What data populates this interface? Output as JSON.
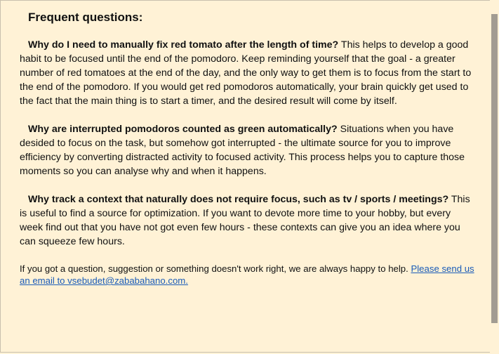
{
  "faq": {
    "title": "Frequent questions:",
    "items": [
      {
        "question": "Why do I need to manually fix red tomato after the length of time?",
        "answer": " This helps to develop a good habit to be focused until the end of the pomodoro. Keep reminding yourself that the goal - a greater number of red tomatoes at the end of the day, and the only way to get them is to focus from the start to the end of the pomodoro. If you would get red pomodoros automatically, your brain quickly get used to the fact that the main thing is to start a timer, and the desired result will come by itself."
      },
      {
        "question": "Why are interrupted pomodoros counted as green automatically?",
        "answer": " Situations when you have desided to focus on the task, but somehow got interrupted - the ultimate source for you to improve efficiency by converting distracted activity to focused activity. This process helps you to capture those moments so you can analyse why and when it happens."
      },
      {
        "question": "Why track a context that naturally does not require focus, such as tv / sports / meetings?",
        "answer": " This is useful to find a source for optimization. If you want to devote more time to your hobby, but every week find out that you have not got even few hours - these contexts can give you an idea where you can squeeze few hours."
      }
    ],
    "footer_text": "If you got a question, suggestion or something doesn't work right, we are always happy to help. ",
    "footer_link": "Please send us an email to vsebudet@zababahano.com."
  }
}
